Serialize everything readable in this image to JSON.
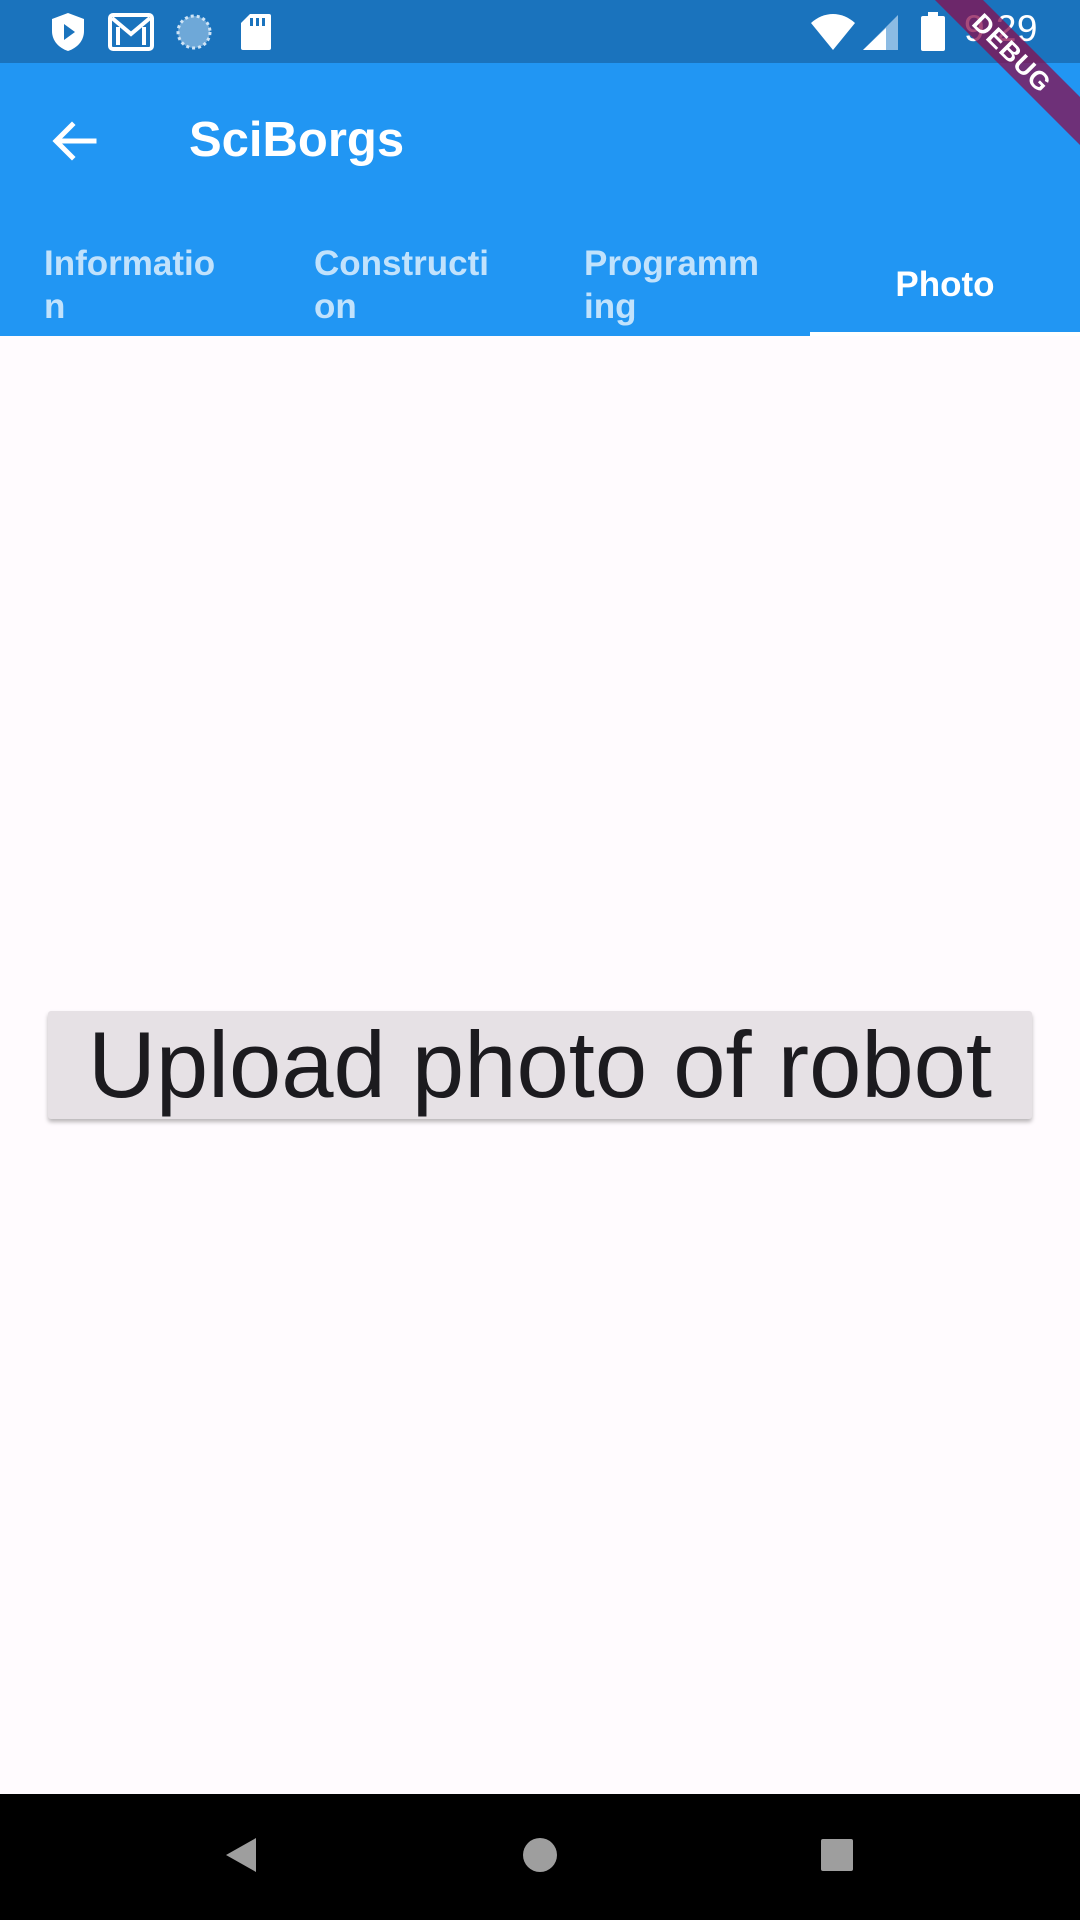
{
  "status_bar": {
    "time": "9:29",
    "icons": [
      "play-protect-icon",
      "gmail-icon",
      "sync-icon",
      "sd-card-icon",
      "wifi-icon",
      "signal-icon",
      "battery-icon"
    ]
  },
  "app_bar": {
    "title": "SciBorgs",
    "back_icon": "arrow-back-icon",
    "color": "#2196f3"
  },
  "tabs": [
    {
      "label": "Information",
      "active": false
    },
    {
      "label": "Construction",
      "active": false
    },
    {
      "label": "Programming",
      "active": false
    },
    {
      "label": "Photo",
      "active": true
    }
  ],
  "debug_banner": "DEBUG",
  "main": {
    "upload_button_label": "Upload photo of robot"
  },
  "nav_bar": {
    "icons": [
      "back-triangle-icon",
      "home-circle-icon",
      "recents-square-icon"
    ]
  }
}
